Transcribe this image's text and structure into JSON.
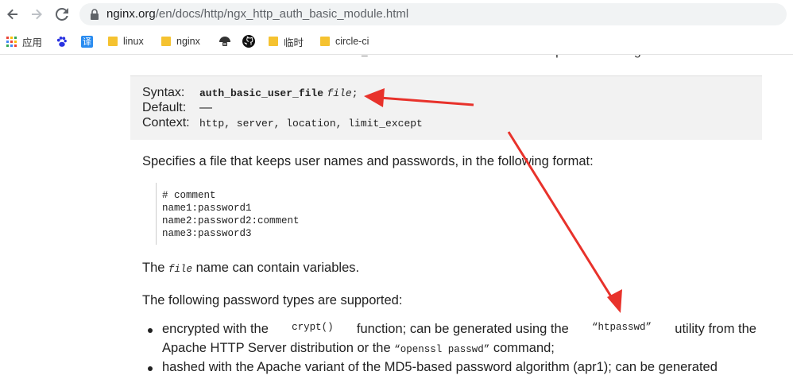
{
  "browser": {
    "url_domain": "nginx.org",
    "url_path": "/en/docs/http/ngx_http_auth_basic_module.html",
    "back_icon": "arrow-left-icon",
    "forward_icon": "arrow-right-icon",
    "reload_icon": "reload-icon",
    "bookmarks": [
      {
        "label": "应用",
        "icon": "apps-grid-icon"
      },
      {
        "label": "",
        "icon": "baidu-paw-icon"
      },
      {
        "label": "",
        "icon": "translate-icon"
      },
      {
        "label": "linux",
        "icon": "folder-icon"
      },
      {
        "label": "nginx",
        "icon": "folder-icon"
      },
      {
        "label": "",
        "icon": "mushroom-icon"
      },
      {
        "label": "",
        "icon": "github-icon"
      },
      {
        "label": "临时",
        "icon": "folder-icon"
      },
      {
        "label": "circle-ci",
        "icon": "folder-icon"
      }
    ],
    "translate_glyph": "译"
  },
  "doc": {
    "clipped_pre": "value ",
    "clipped_code1": "off",
    "clipped_mid": " cancels the effect of the ",
    "clipped_code2": "auth_basic",
    "clipped_post": " directive inherited from the previous configuration level.",
    "directive": {
      "syntax_label": "Syntax:",
      "syntax_name": "auth_basic_user_file",
      "syntax_param": "file",
      "syntax_end": ";",
      "default_label": "Default:",
      "default_value": "—",
      "context_label": "Context:",
      "context_value": "http, server, location, limit_except"
    },
    "para1": "Specifies a file that keeps user names and passwords, in the following format:",
    "pre_lines": [
      "# comment",
      "name1:password1",
      "name2:password2:comment",
      "name3:password3"
    ],
    "para2_pre": "The ",
    "para2_code": "file",
    "para2_post": " name can contain variables.",
    "para3": "The following password types are supported:",
    "bullet1_a": "encrypted with the ",
    "bullet1_code1": "crypt()",
    "bullet1_b": " function; can be generated using the ",
    "bullet1_code2": "“htpasswd”",
    "bullet1_c": " utility from the",
    "bullet1_line2_a": "Apache HTTP Server distribution or the ",
    "bullet1_code3": "“openssl passwd”",
    "bullet1_line2_b": " command;",
    "bullet2": "hashed with the Apache variant of the MD5-based password algorithm (apr1); can be generated"
  },
  "colors": {
    "annotation_arrow": "#e8322b",
    "directive_bg": "#f2f2f2"
  }
}
